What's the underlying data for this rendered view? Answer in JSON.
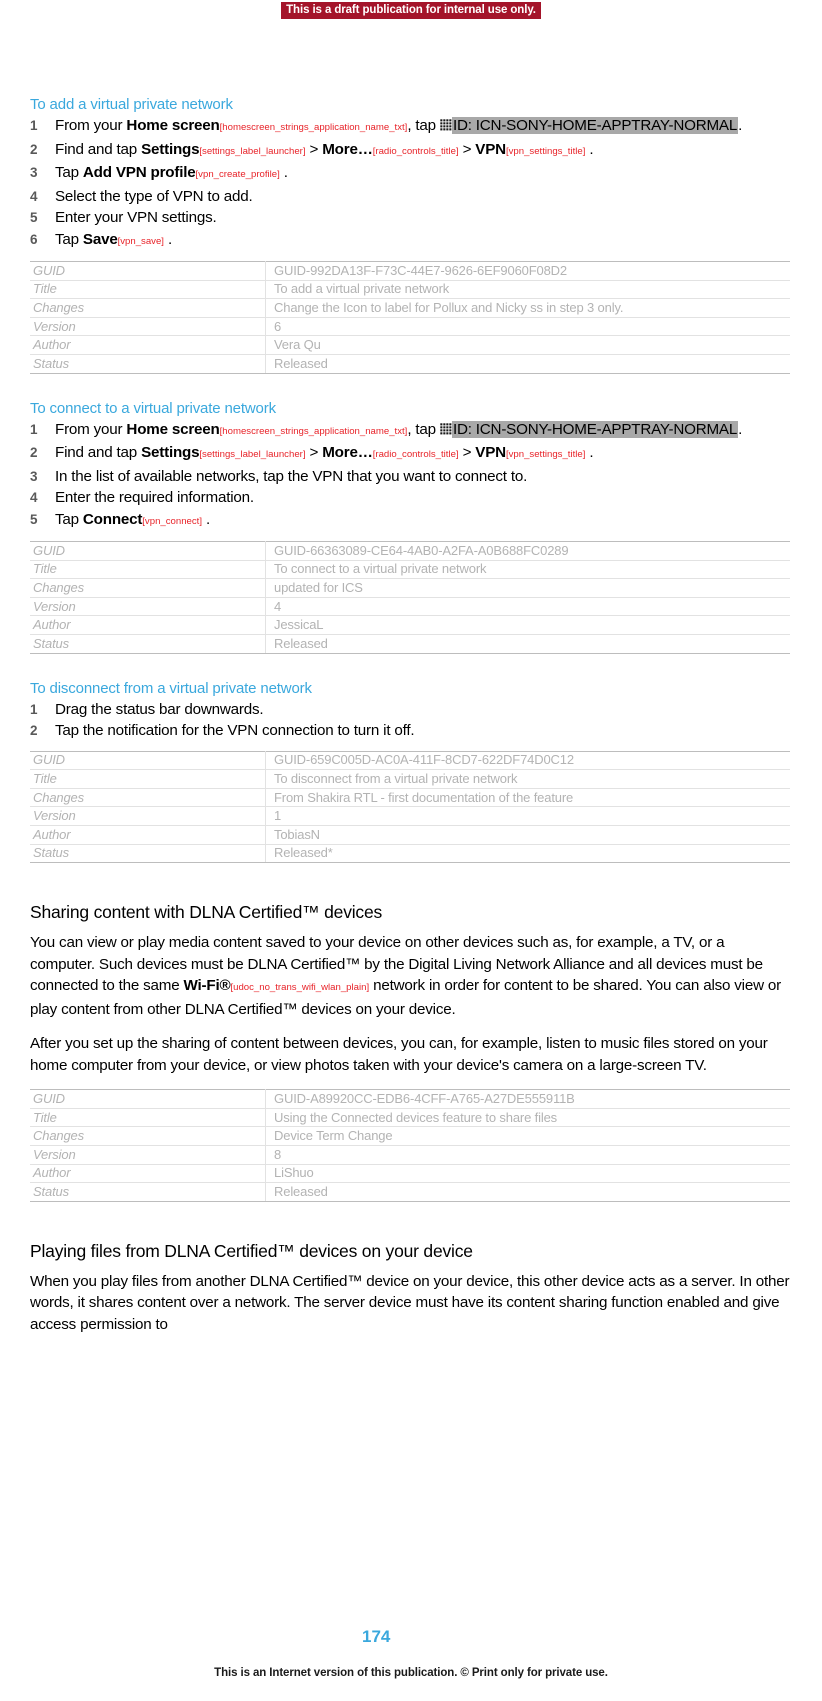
{
  "banner": {
    "draft_notice": "This is a draft publication for internal use only."
  },
  "footer": {
    "page_number": "174",
    "notice": "This is an Internet version of this publication. © Print only for private use."
  },
  "procedures": [
    {
      "heading": "To add a virtual private network",
      "steps": [
        {
          "parts": [
            {
              "t": "text",
              "v": "From your "
            },
            {
              "t": "term",
              "v": "Home screen"
            },
            {
              "t": "tag",
              "v": "[homescreen_strings_application_name_txt]"
            },
            {
              "t": "text",
              "v": ", tap "
            },
            {
              "t": "icon",
              "v": "grid-icon"
            },
            {
              "t": "highlight",
              "v": "ID: ICN-SONY-HOME-APPTRAY-NORMAL"
            },
            {
              "t": "text",
              "v": "."
            }
          ]
        },
        {
          "parts": [
            {
              "t": "text",
              "v": "Find and tap "
            },
            {
              "t": "term",
              "v": "Settings"
            },
            {
              "t": "tag",
              "v": "[settings_label_launcher]"
            },
            {
              "t": "text",
              "v": " > "
            },
            {
              "t": "term",
              "v": "More…"
            },
            {
              "t": "tag",
              "v": "[radio_controls_title]"
            },
            {
              "t": "text",
              "v": " > "
            },
            {
              "t": "term",
              "v": "VPN"
            },
            {
              "t": "tag",
              "v": "[vpn_settings_title]"
            },
            {
              "t": "text",
              "v": " ."
            }
          ]
        },
        {
          "parts": [
            {
              "t": "text",
              "v": "Tap "
            },
            {
              "t": "term",
              "v": "Add VPN profile"
            },
            {
              "t": "tag",
              "v": "[vpn_create_profile]"
            },
            {
              "t": "text",
              "v": " ."
            }
          ]
        },
        {
          "parts": [
            {
              "t": "text",
              "v": "Select the type of VPN to add."
            }
          ]
        },
        {
          "parts": [
            {
              "t": "text",
              "v": "Enter your VPN settings."
            }
          ]
        },
        {
          "parts": [
            {
              "t": "text",
              "v": "Tap "
            },
            {
              "t": "term",
              "v": "Save"
            },
            {
              "t": "tag",
              "v": "[vpn_save]"
            },
            {
              "t": "text",
              "v": " ."
            }
          ]
        }
      ],
      "meta": {
        "labels": [
          "GUID",
          "Title",
          "Changes",
          "Version",
          "Author",
          "Status"
        ],
        "values": [
          "GUID-992DA13F-F73C-44E7-9626-6EF9060F08D2",
          "To add a virtual private network",
          "Change the Icon to label for Pollux and Nicky ss in step 3 only.",
          "6",
          "Vera Qu",
          "Released"
        ]
      }
    },
    {
      "heading": "To connect to a virtual private network",
      "steps": [
        {
          "parts": [
            {
              "t": "text",
              "v": "From your "
            },
            {
              "t": "term",
              "v": "Home screen"
            },
            {
              "t": "tag",
              "v": "[homescreen_strings_application_name_txt]"
            },
            {
              "t": "text",
              "v": ", tap "
            },
            {
              "t": "icon",
              "v": "grid-icon"
            },
            {
              "t": "highlight",
              "v": "ID: ICN-SONY-HOME-APPTRAY-NORMAL"
            },
            {
              "t": "text",
              "v": "."
            }
          ]
        },
        {
          "parts": [
            {
              "t": "text",
              "v": "Find and tap "
            },
            {
              "t": "term",
              "v": "Settings"
            },
            {
              "t": "tag",
              "v": "[settings_label_launcher]"
            },
            {
              "t": "text",
              "v": " > "
            },
            {
              "t": "term",
              "v": "More…"
            },
            {
              "t": "tag",
              "v": "[radio_controls_title]"
            },
            {
              "t": "text",
              "v": " > "
            },
            {
              "t": "term",
              "v": "VPN"
            },
            {
              "t": "tag",
              "v": "[vpn_settings_title]"
            },
            {
              "t": "text",
              "v": " ."
            }
          ]
        },
        {
          "parts": [
            {
              "t": "text",
              "v": "In the list of available networks, tap the VPN that you want to connect to."
            }
          ]
        },
        {
          "parts": [
            {
              "t": "text",
              "v": "Enter the required information."
            }
          ]
        },
        {
          "parts": [
            {
              "t": "text",
              "v": "Tap "
            },
            {
              "t": "term",
              "v": "Connect"
            },
            {
              "t": "tag",
              "v": "[vpn_connect]"
            },
            {
              "t": "text",
              "v": " ."
            }
          ]
        }
      ],
      "meta": {
        "labels": [
          "GUID",
          "Title",
          "Changes",
          "Version",
          "Author",
          "Status"
        ],
        "values": [
          "GUID-66363089-CE64-4AB0-A2FA-A0B688FC0289",
          "To connect to a virtual private network",
          "updated for ICS",
          "4",
          "JessicaL",
          "Released"
        ]
      }
    },
    {
      "heading": "To disconnect from a virtual private network",
      "steps": [
        {
          "parts": [
            {
              "t": "text",
              "v": "Drag the status bar downwards."
            }
          ]
        },
        {
          "parts": [
            {
              "t": "text",
              "v": "Tap the notification for the VPN connection to turn it off."
            }
          ]
        }
      ],
      "meta": {
        "labels": [
          "GUID",
          "Title",
          "Changes",
          "Version",
          "Author",
          "Status"
        ],
        "values": [
          "GUID-659C005D-AC0A-411F-8CD7-622DF74D0C12",
          "To disconnect from a virtual private network",
          "From Shakira RTL - first documentation of the feature",
          "1",
          "TobiasN",
          "Released*"
        ]
      }
    }
  ],
  "dlna_section": {
    "heading": "Sharing content with DLNA Certified™ devices",
    "paragraph1": {
      "parts": [
        {
          "t": "text",
          "v": "You can view or play media content saved to your device on other devices such as, for example, a TV, or a computer. Such devices must be DLNA Certified™ by the Digital Living Network Alliance and all devices must be connected to the same "
        },
        {
          "t": "term",
          "v": "Wi-Fi®"
        },
        {
          "t": "tag",
          "v": "[udoc_no_trans_wifi_wlan_plain]"
        },
        {
          "t": "text",
          "v": " network in order for content to be shared. You can also view or play content from other DLNA Certified™ devices on your device."
        }
      ]
    },
    "paragraph2": "After you set up the sharing of content between devices, you can, for example, listen to music files stored on your home computer from your device, or view photos taken with your device's camera on a large-screen TV.",
    "meta": {
      "labels": [
        "GUID",
        "Title",
        "Changes",
        "Version",
        "Author",
        "Status"
      ],
      "values": [
        "GUID-A89920CC-EDB6-4CFF-A765-A27DE555911B",
        "Using the Connected devices feature to share files",
        "Device Term Change",
        "8",
        "LiShuo",
        "Released"
      ]
    }
  },
  "playing_section": {
    "heading": "Playing files from DLNA Certified™ devices on your device",
    "paragraph": "When you play files from another DLNA Certified™ device on your device, this other device acts as a server. In other words, it shares content over a network. The server device must have its content sharing function enabled and give access permission to"
  }
}
